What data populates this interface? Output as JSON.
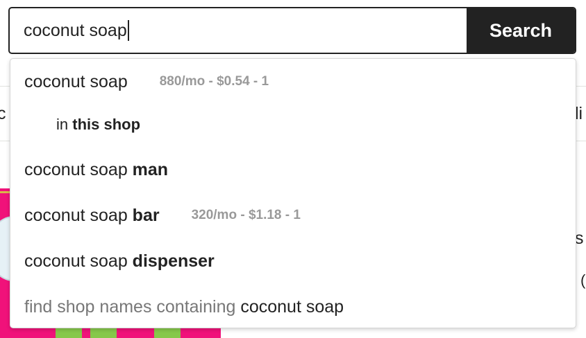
{
  "search": {
    "query": "coconut soap",
    "button_label": "Search"
  },
  "suggestions": [
    {
      "base": "coconut soap",
      "suffix": "",
      "stats": "880/mo - $0.54 - 1"
    },
    {
      "scope_prefix": "in ",
      "scope_bold": "this shop"
    },
    {
      "base": "coconut soap ",
      "suffix": "man",
      "stats": ""
    },
    {
      "base": "coconut soap ",
      "suffix": "bar",
      "stats": "320/mo - $1.18 - 1"
    },
    {
      "base": "coconut soap ",
      "suffix": "dispenser",
      "stats": ""
    },
    {
      "prefix": "find shop names containing ",
      "term": "coconut soap"
    }
  ],
  "background": {
    "left_edge_text": "c",
    "right_edge_text": "li",
    "right_edge_text_2": "s",
    "right_edge_text_3": "(",
    "product_colors": {
      "pink": "#f0127a",
      "green": "#86c84a"
    }
  },
  "colors": {
    "button_bg": "#222222",
    "stats_gray": "#999999",
    "muted_text": "#777777",
    "border": "#222222"
  }
}
